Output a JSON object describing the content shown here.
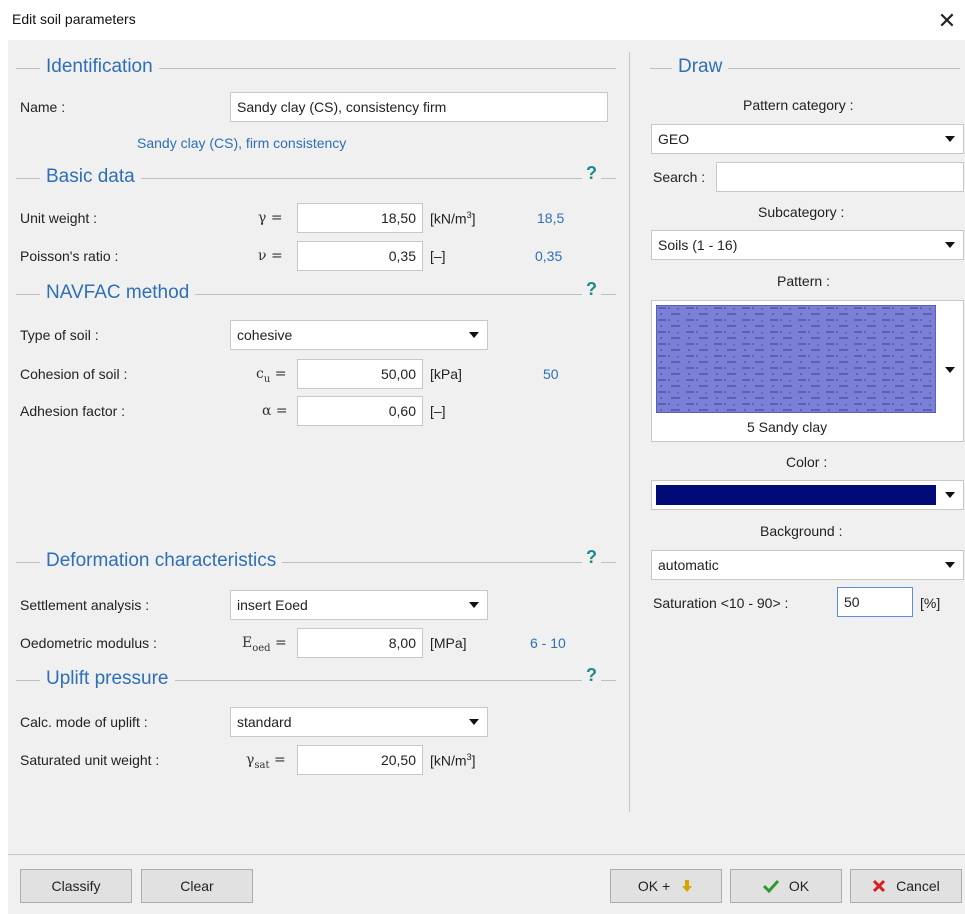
{
  "window": {
    "title": "Edit soil parameters",
    "close_glyph": "✕"
  },
  "identification": {
    "section_title": "Identification",
    "name_label": "Name :",
    "name_value": "Sandy clay (CS), consistency firm",
    "name_hint": "Sandy clay (CS), firm consistency"
  },
  "basic_data": {
    "section_title": "Basic data",
    "help": "?",
    "unit_weight": {
      "label": "Unit weight :",
      "symbol": "γ =",
      "value": "18,50",
      "unit_pre": "[kN/m",
      "unit_sup": "3",
      "unit_post": "]",
      "hint": "18,5"
    },
    "poisson": {
      "label": "Poisson's ratio :",
      "symbol": "ν =",
      "value": "0,35",
      "unit": "[–]",
      "hint": "0,35"
    }
  },
  "navfac": {
    "section_title": "NAVFAC method",
    "help": "?",
    "type_of_soil": {
      "label": "Type of soil :",
      "value": "cohesive"
    },
    "cohesion": {
      "label": "Cohesion of soil :",
      "symbol_main": "c",
      "symbol_sub": "u",
      "symbol_eq": " =",
      "value": "50,00",
      "unit": "[kPa]",
      "hint": "50"
    },
    "adhesion": {
      "label": "Adhesion factor :",
      "symbol": "α =",
      "value": "0,60",
      "unit": "[–]"
    }
  },
  "deformation": {
    "section_title": "Deformation characteristics",
    "help": "?",
    "settlement": {
      "label": "Settlement analysis :",
      "value": "insert Eoed"
    },
    "oedometric": {
      "label": "Oedometric modulus :",
      "symbol_main": "E",
      "symbol_sub": "oed",
      "symbol_eq": " =",
      "value": "8,00",
      "unit": "[MPa]",
      "hint": "6 - 10"
    }
  },
  "uplift": {
    "section_title": "Uplift pressure",
    "help": "?",
    "calc_mode": {
      "label": "Calc. mode of uplift :",
      "value": "standard"
    },
    "saturated": {
      "label": "Saturated unit weight :",
      "symbol_main": "γ",
      "symbol_sub": "sat",
      "symbol_eq": " =",
      "value": "20,50",
      "unit_pre": "[kN/m",
      "unit_sup": "3",
      "unit_post": "]"
    }
  },
  "draw": {
    "section_title": "Draw",
    "pattern_category_label": "Pattern category :",
    "pattern_category_value": "GEO",
    "search_label": "Search :",
    "search_value": "",
    "subcategory_label": "Subcategory :",
    "subcategory_value": "Soils (1 - 16)",
    "pattern_label": "Pattern :",
    "pattern_name": "5 Sandy clay",
    "color_label": "Color :",
    "color_value": "#000b78",
    "background_label": "Background :",
    "background_value": "automatic",
    "saturation_label": "Saturation <10 - 90> :",
    "saturation_value": "50",
    "saturation_unit": "[%]"
  },
  "buttons": {
    "classify": "Classify",
    "clear": "Clear",
    "ok_plus": "OK +",
    "ok": "OK",
    "cancel": "Cancel"
  },
  "icons": {
    "ok_plus_icon": "down-arrow-icon",
    "ok_icon": "checkmark-icon",
    "cancel_icon": "x-mark-icon"
  }
}
